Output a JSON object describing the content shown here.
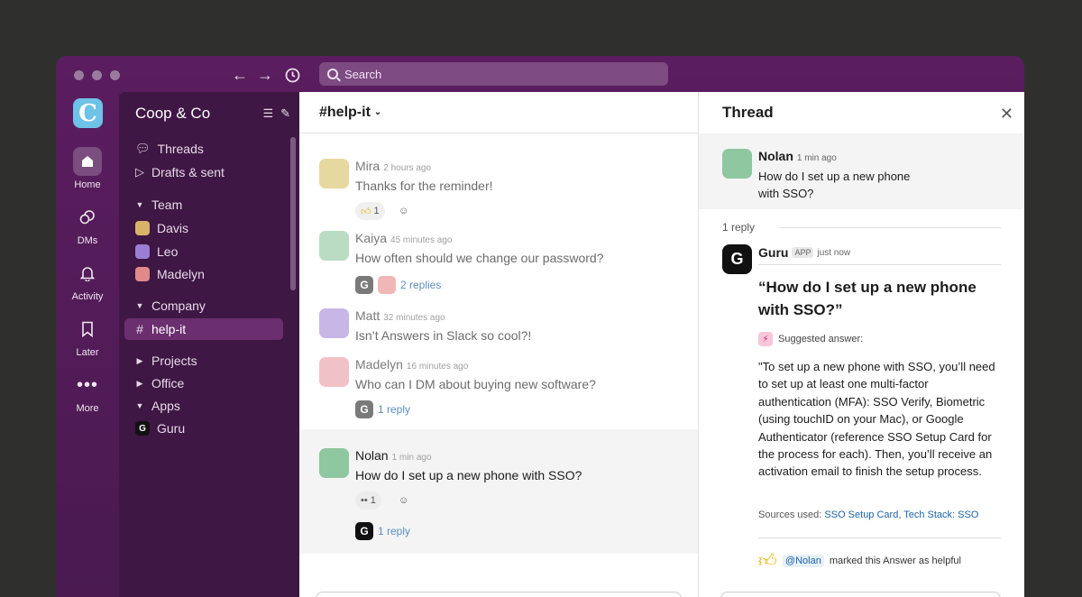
{
  "search": {
    "placeholder": "Search"
  },
  "rail": {
    "workspace_initial": "C",
    "items": [
      {
        "label": "Home",
        "icon": "home-icon"
      },
      {
        "label": "DMs",
        "icon": "dms-icon"
      },
      {
        "label": "Activity",
        "icon": "bell-icon"
      },
      {
        "label": "Later",
        "icon": "bookmark-icon"
      },
      {
        "label": "More",
        "icon": "more-icon"
      }
    ]
  },
  "sidebar": {
    "workspace": "Coop & Co",
    "threads": "Threads",
    "drafts": "Drafts & sent",
    "team_section": "Team",
    "team": [
      "Davis",
      "Leo",
      "Madelyn"
    ],
    "company_section": "Company",
    "channel_active": "help-it",
    "projects": "Projects",
    "office": "Office",
    "apps_section": "Apps",
    "app_guru": "Guru"
  },
  "channel": {
    "name": "#help-it",
    "messages": [
      {
        "author": "Mira",
        "time": "2 hours ago",
        "text": "Thanks for the reminder!",
        "reaction": "1"
      },
      {
        "author": "Kaiya",
        "time": "45 minutes ago",
        "text": "How often should we change our password?",
        "replies": "2 replies"
      },
      {
        "author": "Matt",
        "time": "32 minutes ago",
        "text": "Isn’t Answers in Slack so cool?!"
      },
      {
        "author": "Madelyn",
        "time": "16 minutes ago",
        "text": "Who can I DM about buying new software?",
        "replies": "1 reply"
      },
      {
        "author": "Nolan",
        "time": "1 min ago",
        "text": "How do I set up a new phone with SSO?",
        "reaction": "1",
        "replies": "1 reply"
      }
    ]
  },
  "thread": {
    "title": "Thread",
    "parent": {
      "author": "Nolan",
      "time": "1 min ago",
      "text": "How do I set up a new phone with SSO?"
    },
    "reply_count": "1 reply",
    "reply": {
      "author": "Guru",
      "badge": "APP",
      "time": "just now",
      "question": "“How do I set up a new phone with SSO?”",
      "suggested_label": "Suggested answer:",
      "answer": "\"To set up a new phone with SSO, you’ll need to set up at least one multi-factor authentication (MFA): SSO Verify, Biometric (using touchID on your Mac), or Google Authenticator (reference SSO Setup Card for the process for each). Then, you’ll receive an activation email to finish the setup process.",
      "sources_label": "Sources used:",
      "source_1": "SSO Setup Card",
      "source_sep": ", ",
      "source_2": "Tech Stack: SSO",
      "helpful_mention": "@Nolan",
      "helpful_text": "marked this Answer as helpful"
    }
  },
  "colors": {
    "window": "#4a1a51",
    "sidebar": "#3f1744",
    "active_channel": "#6b2f6f",
    "link": "#1d64a8"
  }
}
